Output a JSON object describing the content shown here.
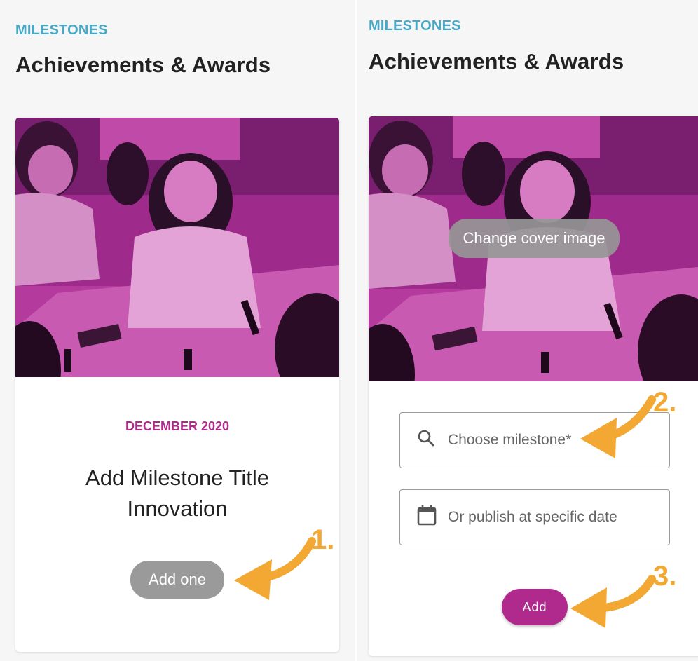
{
  "left": {
    "eyebrow": "MILESTONES",
    "heading": "Achievements & Awards",
    "card": {
      "date": "DECEMBER 2020",
      "title_line1": "Add Milestone Title",
      "title_line2": "Innovation",
      "add_one_label": "Add one"
    }
  },
  "right": {
    "eyebrow": "MILESTONES",
    "heading": "Achievements & Awards",
    "card": {
      "change_cover_label": "Change cover image",
      "milestone_placeholder": "Choose milestone*",
      "date_placeholder": "Or publish at specific date",
      "add_label": "Add"
    }
  },
  "annotations": {
    "step1": "1.",
    "step2": "2.",
    "step3": "3."
  },
  "colors": {
    "accent_magenta": "#b02a8e",
    "eyebrow_blue": "#47a9c7",
    "annotation_orange": "#f2a833",
    "pill_grey": "#9a9a9a"
  }
}
